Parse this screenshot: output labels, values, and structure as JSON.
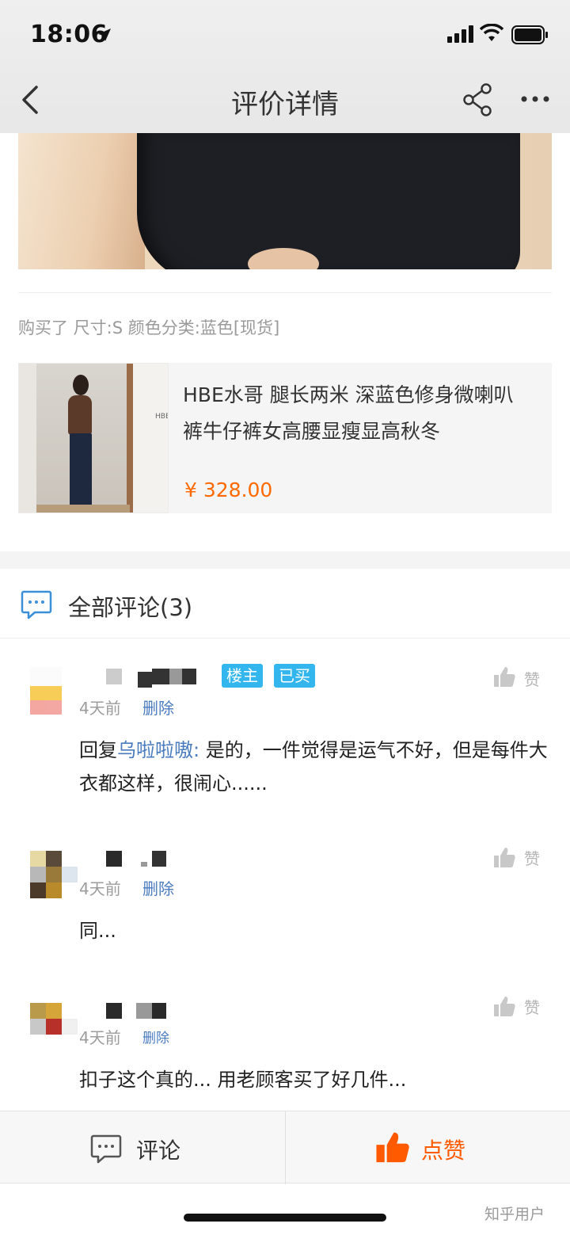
{
  "status_bar": {
    "time": "18:06"
  },
  "nav": {
    "title": "评价详情"
  },
  "purchase_info": "购买了 尺寸:S 颜色分类:蓝色[现货]",
  "product": {
    "title": "HBE水哥 腿长两米 深蓝色修身微喇叭裤牛仔裤女高腰显瘦显高秋冬",
    "price": "¥ 328.00",
    "image_text": "HBE"
  },
  "comments_section": {
    "title": "全部评论(3)"
  },
  "comments": [
    {
      "badges": [
        "楼主",
        "已买"
      ],
      "time": "4天前",
      "delete_label": "删除",
      "like_label": "赞",
      "reply_prefix": "回复",
      "reply_to": "乌啦啦嗷",
      "reply_sep": ": ",
      "text": "是的，一件觉得是运气不好，但是每件大衣都这样，很闹心......"
    },
    {
      "time": "4天前",
      "delete_label": "删除",
      "like_label": "赞",
      "text": "同..."
    },
    {
      "time": "4天前",
      "delete_label": "删除",
      "like_label": "赞",
      "text": "扣子这个真的... 用老顾客买了好几件..."
    }
  ],
  "bottom_bar": {
    "comment_label": "评论",
    "like_label": "点赞"
  },
  "watermark": "知乎用户",
  "colors": {
    "accent": "#ff5a00",
    "link": "#4a7bbf",
    "badge": "#33b6ee",
    "price": "#ff6a00"
  }
}
